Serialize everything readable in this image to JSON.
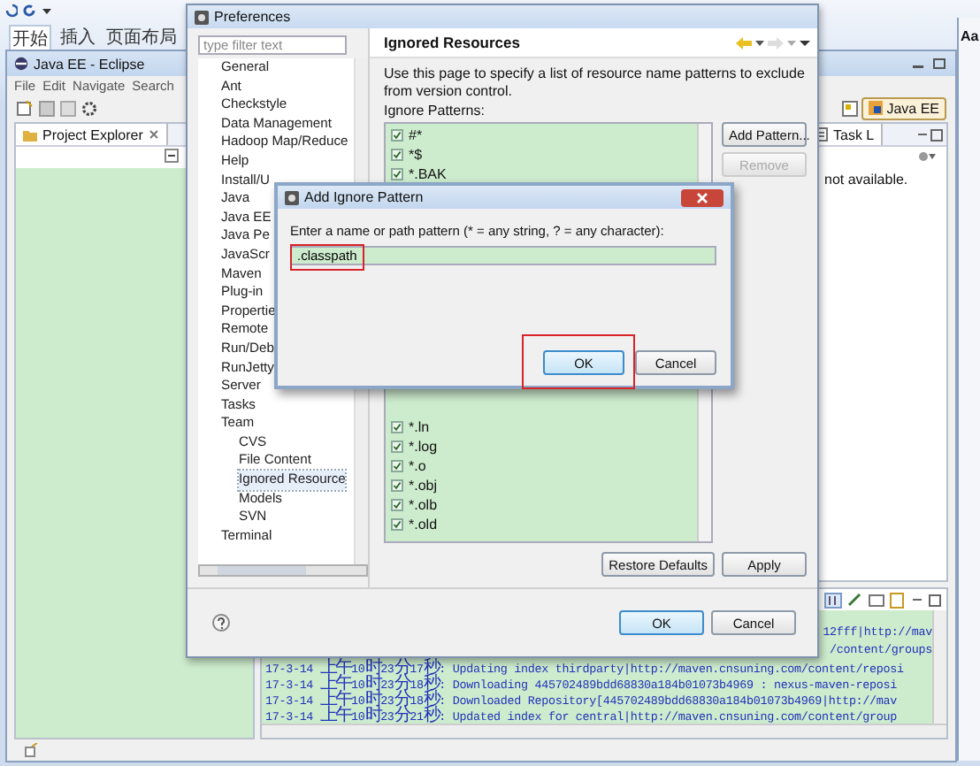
{
  "word": {
    "tabs": [
      {
        "label": "开始",
        "selected": true
      },
      {
        "label": "插入",
        "selected": false
      },
      {
        "label": "页面布局",
        "selected": false
      }
    ]
  },
  "eclipse": {
    "title": "Java EE - Eclipse",
    "menu": [
      "File",
      "Edit",
      "Navigate",
      "Search"
    ],
    "explorer_tab": "Project Explorer",
    "perspective": "Java EE",
    "task_tab": "Task L",
    "task_message": "not available.",
    "console": [
      {
        "kind": "partial",
        "text": "12fff|http://mav"
      },
      {
        "kind": "partial",
        "text": "/content/groups"
      },
      {
        "kind": "full",
        "text": "17-3-14 上午10时23分17秒: Updating index thirdparty|http://maven.cnsuning.com/content/reposi"
      },
      {
        "kind": "full",
        "text": "17-3-14 上午10时23分18秒: Downloading 445702489bdd68830a184b01073b4969 : nexus-maven-reposi"
      },
      {
        "kind": "full",
        "text": "17-3-14 上午10时23分18秒: Downloaded Repository[445702489bdd68830a184b01073b4969|http://mav"
      },
      {
        "kind": "full",
        "text": "17-3-14 上午10时23分21秒: Updated index for central|http://maven.cnsuning.com/content/group"
      }
    ]
  },
  "side_window": {
    "label": "Aa"
  },
  "preferences": {
    "title": "Preferences",
    "filter_placeholder": "type filter text",
    "tree": [
      {
        "label": "General",
        "selected": false
      },
      {
        "label": "Ant",
        "selected": false
      },
      {
        "label": "Checkstyle",
        "selected": false
      },
      {
        "label": "Data Management",
        "selected": false
      },
      {
        "label": "Hadoop Map/Reduce",
        "selected": false
      },
      {
        "label": "Help",
        "selected": false
      },
      {
        "label": "Install/U",
        "selected": false
      },
      {
        "label": "Java",
        "selected": false
      },
      {
        "label": "Java EE",
        "selected": false
      },
      {
        "label": "Java Pe",
        "selected": false
      },
      {
        "label": "JavaScr",
        "selected": false
      },
      {
        "label": "Maven",
        "selected": false
      },
      {
        "label": "Plug-in",
        "selected": false
      },
      {
        "label": "Propertie",
        "selected": false
      },
      {
        "label": "Remote",
        "selected": false
      },
      {
        "label": "Run/Deb",
        "selected": false
      },
      {
        "label": "RunJetty",
        "selected": false
      },
      {
        "label": "Server",
        "selected": false
      },
      {
        "label": "Tasks",
        "selected": false
      },
      {
        "label": "Team",
        "selected": false,
        "children": [
          {
            "label": "CVS",
            "selected": false
          },
          {
            "label": "File Content",
            "selected": false
          },
          {
            "label": "Ignored Resource",
            "selected": true
          },
          {
            "label": "Models",
            "selected": false
          },
          {
            "label": "SVN",
            "selected": false
          }
        ]
      },
      {
        "label": "Terminal",
        "selected": false
      }
    ],
    "page_title": "Ignored Resources",
    "description": "Use this page to specify a list of resource name patterns to exclude from version control.",
    "patterns_label": "Ignore Patterns:",
    "patterns_top": [
      {
        "text": "#*",
        "checked": true
      },
      {
        "text": "*$",
        "checked": true
      },
      {
        "text": "*.BAK",
        "checked": true
      }
    ],
    "patterns_bottom": [
      {
        "text": "*.ln",
        "checked": true
      },
      {
        "text": "*.log",
        "checked": true
      },
      {
        "text": "*.o",
        "checked": true
      },
      {
        "text": "*.obj",
        "checked": true
      },
      {
        "text": "*.olb",
        "checked": true
      },
      {
        "text": "*.old",
        "checked": true
      }
    ],
    "side_buttons": [
      {
        "label": "Add Pattern...",
        "disabled": false
      },
      {
        "label": "Remove",
        "disabled": true
      }
    ],
    "restore": "Restore Defaults",
    "apply": "Apply",
    "ok": "OK",
    "cancel": "Cancel"
  },
  "dialog": {
    "title": "Add Ignore Pattern",
    "prompt": "Enter a name or path pattern (* = any string, ? = any character):",
    "value": ".classpath",
    "value_highlighted": true,
    "ok": "OK",
    "ok_highlighted": true,
    "cancel": "Cancel"
  }
}
